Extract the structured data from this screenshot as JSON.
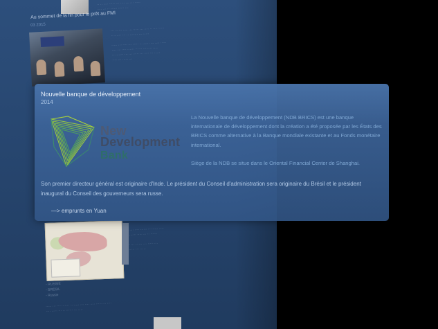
{
  "card": {
    "title": "Nouvelle banque de développement",
    "year": "2014",
    "logo": {
      "line1": "New",
      "line2": "Development",
      "line3": "Bank",
      "icon": "ndb-triangle-logo"
    },
    "description": "La Nouvelle banque de développement (NDB BRICS) est une banque internationale de développement dont la création a été proposée par les États des BRICS comme alternative à la Banque mondiale existante et au Fonds monétaire international.",
    "seat": "Siège de la NDB se situe dans le Oriental Financial Center de Shanghai.",
    "paragraph": "Son premier directeur général est originaire d'Inde. Le président du Conseil d'administration sera originaire du Brésil et le président inaugural du Conseil des gouverneurs sera russe.",
    "link": "—> emprunts en Yuan"
  },
  "background": {
    "heading": "Au sommet de la fin pour le prêt au FMI",
    "date": "03 2015",
    "list": [
      "- RUSSIE",
      "- BRÉSIL",
      "- Russie"
    ]
  },
  "colors": {
    "card_bg": "#3f6596",
    "page_bg": "#27466f",
    "logo_green": "#8fc23f",
    "logo_teal": "#2f7f7a"
  }
}
